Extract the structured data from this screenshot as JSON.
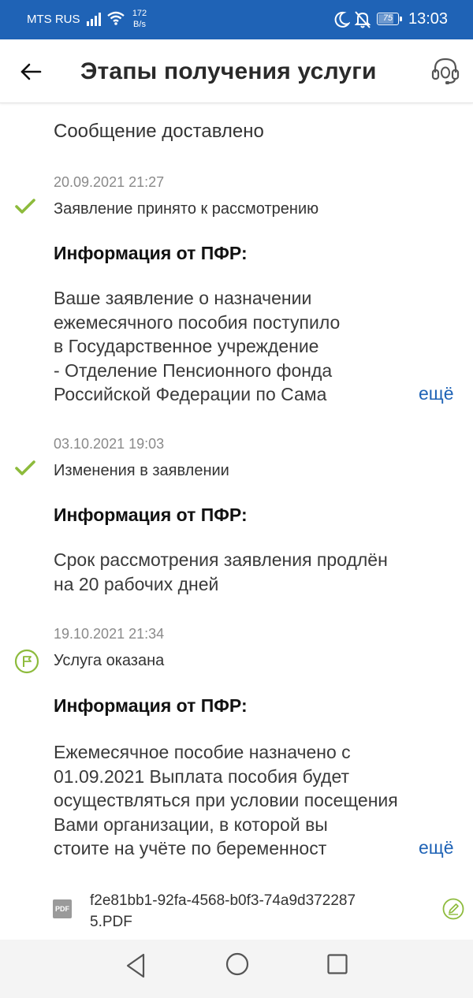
{
  "status_bar": {
    "carrier": "MTS RUS",
    "net_speed_value": "172",
    "net_speed_unit": "B/s",
    "battery": "75",
    "time": "13:03"
  },
  "header": {
    "title": "Этапы получения услуги",
    "back_icon": "arrow-left-icon",
    "support_icon": "headset-icon"
  },
  "timeline": {
    "initial_status": "Сообщение доставлено",
    "stages": [
      {
        "date": "20.09.2021 21:27",
        "status_icon": "check-icon",
        "label": "Заявление принято к рассмотрению",
        "info_title": "Информация от ПФР:",
        "info_lines": [
          "Ваше заявление о назначении",
          "ежемесячного пособия поступило",
          "в Государственное учреждение",
          "- Отделение Пенсионного фонда",
          "Российской Федерации по Сама"
        ],
        "more_label": "ещё"
      },
      {
        "date": "03.10.2021 19:03",
        "status_icon": "check-icon",
        "label": "Изменения в заявлении",
        "info_title": "Информация от ПФР:",
        "info_lines": [
          "Срок рассмотрения заявления продлён",
          "на 20 рабочих дней"
        ]
      },
      {
        "date": "19.10.2021 21:34",
        "status_icon": "flag-icon",
        "label": "Услуга оказана",
        "info_title": "Информация от ПФР:",
        "info_lines": [
          "Ежемесячное пособие назначено с",
          "01.09.2021 Выплата пособия будет",
          "осуществляться при условии посещения",
          "Вами организации, в которой вы",
          "стоите на учёте по беременност"
        ],
        "more_label": "ещё"
      }
    ],
    "attachment": {
      "type_label": "PDF",
      "file_name_line1": "f2e81bb1-92fa-4568-b0f3-74a9d372287",
      "file_name_line2": "5.PDF",
      "action_icon": "signature-icon"
    }
  },
  "nav_bar": {
    "back_icon": "triangle-back-icon",
    "home_icon": "circle-home-icon",
    "recents_icon": "square-recents-icon"
  },
  "colors": {
    "status_bar": "#1f63b6",
    "accent_link": "#1f63b6",
    "check_green": "#8dbb3c"
  }
}
